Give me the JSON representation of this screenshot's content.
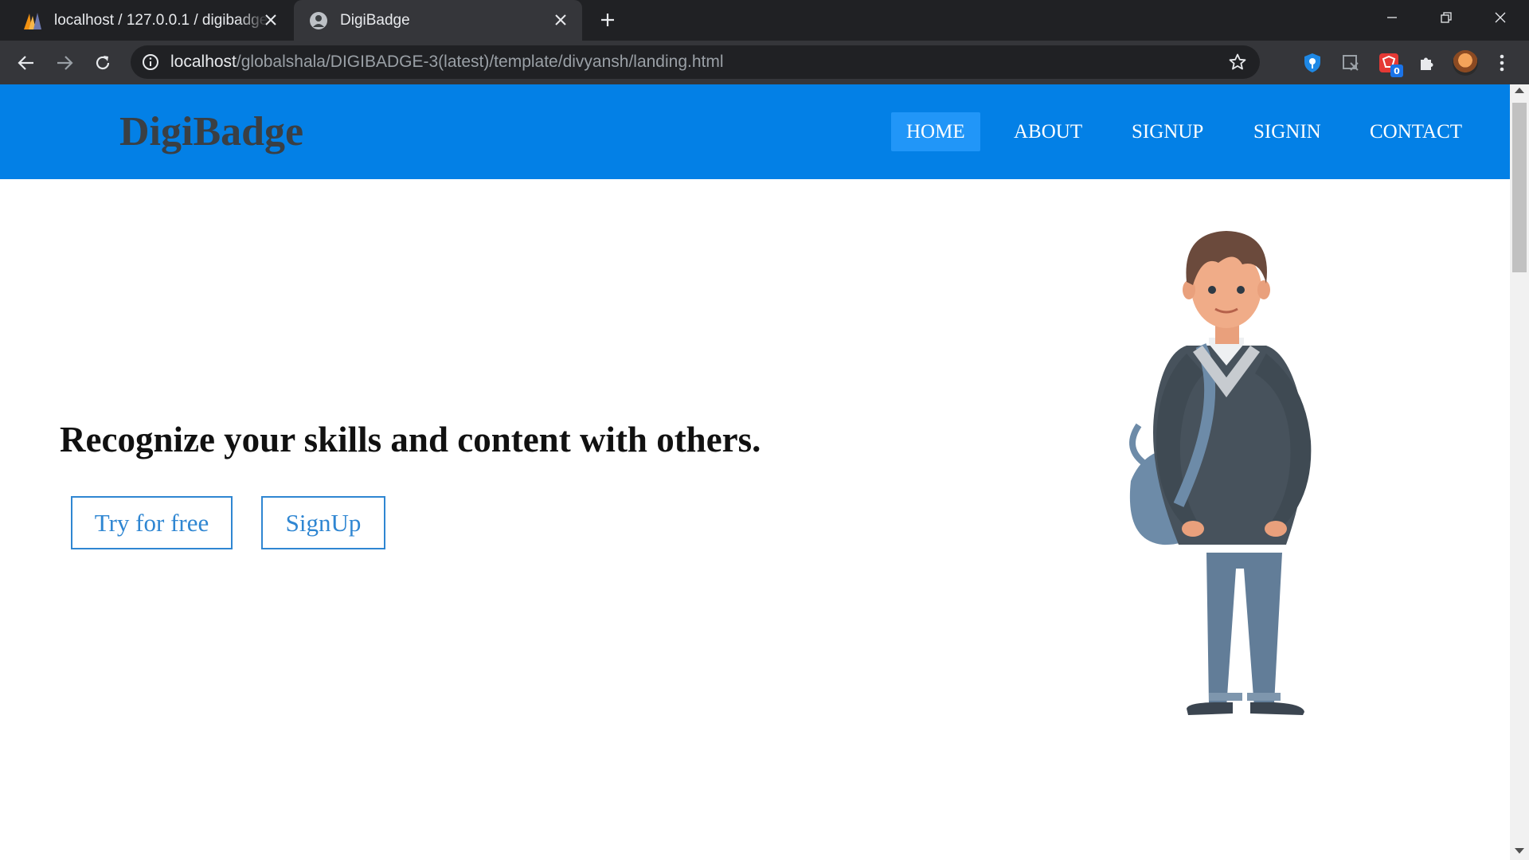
{
  "browser": {
    "tabs": [
      {
        "title": "localhost / 127.0.0.1 / digibadge",
        "icon": "phpmyadmin-icon",
        "active": false
      },
      {
        "title": "DigiBadge",
        "icon": "site-favicon-icon",
        "active": true
      }
    ],
    "address": {
      "host": "localhost",
      "path": "/globalshala/DIGIBADGE-3(latest)/template/divyansh/landing.html"
    },
    "extension_badge": "0"
  },
  "site": {
    "logo": "DigiBadge",
    "nav": [
      "HOME",
      "ABOUT",
      "SIGNUP",
      "SIGNIN",
      "CONTACT"
    ],
    "active_nav": "HOME",
    "hero": {
      "title": "Recognize your skills and content with others.",
      "primary_button": "Try for free",
      "secondary_button": "SignUp"
    }
  },
  "colors": {
    "header_bg": "#0380e6",
    "active_nav_bg": "#2196f8",
    "logo_text": "#3a3f44",
    "button_text": "#2f86d2"
  }
}
